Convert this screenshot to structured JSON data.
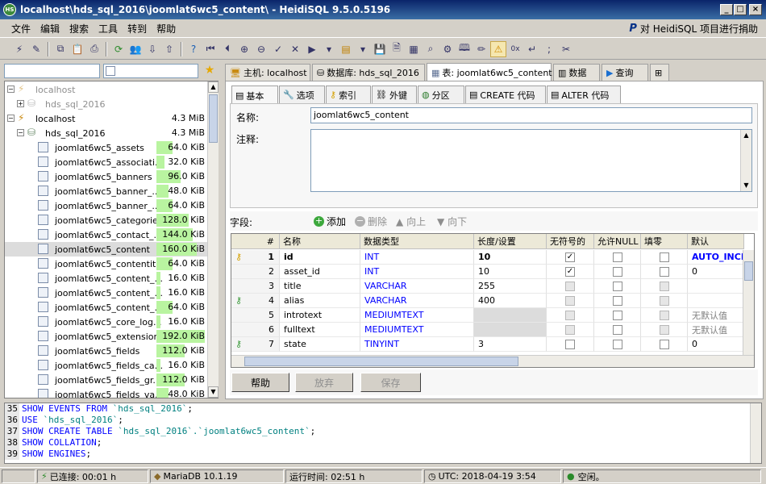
{
  "window": {
    "title": "localhost\\hds_sql_2016\\joomlat6wc5_content\\ - HeidiSQL 9.5.0.5196",
    "app_icon": "HS"
  },
  "menu": {
    "items": [
      "文件",
      "编辑",
      "搜索",
      "工具",
      "转到",
      "帮助"
    ],
    "donate": "对 HeidiSQL 项目进行捐助",
    "donate_logo": "P"
  },
  "tree": {
    "nodes": [
      {
        "label": "localhost",
        "size": "",
        "level": 0,
        "type": "server",
        "dim": true,
        "expander": "−"
      },
      {
        "label": "hds_sql_2016",
        "size": "",
        "level": 1,
        "type": "db",
        "dim": true,
        "expander": "+"
      },
      {
        "label": "localhost",
        "size": "4.3 MiB",
        "level": 0,
        "type": "server",
        "dim": false,
        "expander": "−"
      },
      {
        "label": "hds_sql_2016",
        "size": "4.3 MiB",
        "level": 1,
        "type": "db",
        "dim": false,
        "expander": "−"
      },
      {
        "label": "joomlat6wc5_assets",
        "size": "64.0 KiB",
        "level": 2,
        "type": "table",
        "fill": 0.33
      },
      {
        "label": "joomlat6wc5_associati...",
        "size": "32.0 KiB",
        "level": 2,
        "type": "table",
        "fill": 0.17
      },
      {
        "label": "joomlat6wc5_banners",
        "size": "96.0 KiB",
        "level": 2,
        "type": "table",
        "fill": 0.5
      },
      {
        "label": "joomlat6wc5_banner_...",
        "size": "48.0 KiB",
        "level": 2,
        "type": "table",
        "fill": 0.25
      },
      {
        "label": "joomlat6wc5_banner_...",
        "size": "64.0 KiB",
        "level": 2,
        "type": "table",
        "fill": 0.33
      },
      {
        "label": "joomlat6wc5_categories",
        "size": "128.0 KiB",
        "level": 2,
        "type": "table",
        "fill": 0.67
      },
      {
        "label": "joomlat6wc5_contact_...",
        "size": "144.0 KiB",
        "level": 2,
        "type": "table",
        "fill": 0.75
      },
      {
        "label": "joomlat6wc5_content",
        "size": "160.0 KiB",
        "level": 2,
        "type": "table",
        "fill": 0.83,
        "selected": true
      },
      {
        "label": "joomlat6wc5_contentit...",
        "size": "64.0 KiB",
        "level": 2,
        "type": "table",
        "fill": 0.33
      },
      {
        "label": "joomlat6wc5_content_...",
        "size": "16.0 KiB",
        "level": 2,
        "type": "table",
        "fill": 0.08
      },
      {
        "label": "joomlat6wc5_content_...",
        "size": "16.0 KiB",
        "level": 2,
        "type": "table",
        "fill": 0.08
      },
      {
        "label": "joomlat6wc5_content_...",
        "size": "64.0 KiB",
        "level": 2,
        "type": "table",
        "fill": 0.33
      },
      {
        "label": "joomlat6wc5_core_log...",
        "size": "16.0 KiB",
        "level": 2,
        "type": "table",
        "fill": 0.08
      },
      {
        "label": "joomlat6wc5_extensions",
        "size": "192.0 KiB",
        "level": 2,
        "type": "table",
        "fill": 1.0
      },
      {
        "label": "joomlat6wc5_fields",
        "size": "112.0 KiB",
        "level": 2,
        "type": "table",
        "fill": 0.58
      },
      {
        "label": "joomlat6wc5_fields_ca...",
        "size": "16.0 KiB",
        "level": 2,
        "type": "table",
        "fill": 0.08
      },
      {
        "label": "joomlat6wc5_fields_gr...",
        "size": "112.0 KiB",
        "level": 2,
        "type": "table",
        "fill": 0.58
      },
      {
        "label": "joomlat6wc5_fields_va...",
        "size": "48.0 KiB",
        "level": 2,
        "type": "table",
        "fill": 0.25
      }
    ]
  },
  "main_tabs": [
    {
      "label": "主机: localhost",
      "icon": "server-icon"
    },
    {
      "label": "数据库: hds_sql_2016",
      "icon": "database-icon"
    },
    {
      "label": "表: joomlat6wc5_content",
      "icon": "table-icon",
      "active": true
    },
    {
      "label": "数据",
      "icon": "grid-icon"
    },
    {
      "label": "查询",
      "icon": "play-icon"
    },
    {
      "label": "",
      "icon": "new-query-tab-icon"
    }
  ],
  "sub_tabs": [
    {
      "label": "基本",
      "active": true
    },
    {
      "label": "选项"
    },
    {
      "label": "索引"
    },
    {
      "label": "外键"
    },
    {
      "label": "分区"
    },
    {
      "label": "CREATE 代码"
    },
    {
      "label": "ALTER 代码"
    }
  ],
  "form": {
    "name_label": "名称:",
    "name_value": "joomlat6wc5_content",
    "comment_label": "注释:"
  },
  "fields": {
    "label": "字段:",
    "add": "添加",
    "remove": "删除",
    "up": "向上",
    "down": "向下"
  },
  "grid": {
    "headers": [
      "#",
      "名称",
      "数据类型",
      "长度/设置",
      "无符号的",
      "允许NULL",
      "填零",
      "默认"
    ],
    "rows": [
      {
        "key": "primary",
        "num": "1",
        "name": "id",
        "type": "INT",
        "length": "10",
        "unsigned": true,
        "allow_null": false,
        "zerofill": false,
        "default": "AUTO_INCREMENT",
        "bold": true
      },
      {
        "key": "",
        "num": "2",
        "name": "asset_id",
        "type": "INT",
        "length": "10",
        "unsigned": true,
        "allow_null": false,
        "zerofill": false,
        "default": "0"
      },
      {
        "key": "",
        "num": "3",
        "name": "title",
        "type": "VARCHAR",
        "length": "255",
        "unsigned": false,
        "allow_null": false,
        "zerofill": false,
        "default": "",
        "dis_unsigned": true,
        "dis_zerofill": true
      },
      {
        "key": "index",
        "num": "4",
        "name": "alias",
        "type": "VARCHAR",
        "length": "400",
        "unsigned": false,
        "allow_null": false,
        "zerofill": false,
        "default": "",
        "dis_unsigned": true,
        "dis_zerofill": true
      },
      {
        "key": "",
        "num": "5",
        "name": "introtext",
        "type": "MEDIUMTEXT",
        "length": "",
        "unsigned": false,
        "allow_null": false,
        "zerofill": false,
        "default": "无默认值",
        "dis_unsigned": true,
        "dis_zerofill": true,
        "gray_len": true
      },
      {
        "key": "",
        "num": "6",
        "name": "fulltext",
        "type": "MEDIUMTEXT",
        "length": "",
        "unsigned": false,
        "allow_null": false,
        "zerofill": false,
        "default": "无默认值",
        "dis_unsigned": true,
        "dis_zerofill": true,
        "gray_len": true
      },
      {
        "key": "index",
        "num": "7",
        "name": "state",
        "type": "TINYINT",
        "length": "3",
        "unsigned": false,
        "allow_null": false,
        "zerofill": false,
        "default": "0"
      }
    ]
  },
  "buttons": {
    "help": "帮助",
    "discard": "放弃",
    "save": "保存"
  },
  "sql_log": [
    {
      "num": "35",
      "parts": [
        [
          "kw",
          "SHOW EVENTS FROM "
        ],
        [
          "str",
          "`hds_sql_2016`"
        ],
        [
          "",
          ";"
        ]
      ]
    },
    {
      "num": "36",
      "parts": [
        [
          "kw",
          "USE "
        ],
        [
          "str",
          "`hds_sql_2016`"
        ],
        [
          "",
          ";"
        ]
      ]
    },
    {
      "num": "37",
      "parts": [
        [
          "kw",
          "SHOW CREATE TABLE "
        ],
        [
          "str",
          "`hds_sql_2016`.`joomlat6wc5_content`"
        ],
        [
          "",
          ";"
        ]
      ]
    },
    {
      "num": "38",
      "parts": [
        [
          "kw",
          "SHOW COLLATION"
        ],
        [
          "",
          ";"
        ]
      ]
    },
    {
      "num": "39",
      "parts": [
        [
          "kw",
          "SHOW ENGINES"
        ],
        [
          "",
          ";"
        ]
      ]
    }
  ],
  "status": {
    "connected": "已连接: 00:01 h",
    "server": "MariaDB 10.1.19",
    "runtime": "运行时间: 02:51 h",
    "utc": "UTC: 2018-04-19 3:54",
    "state": "空闲。"
  }
}
